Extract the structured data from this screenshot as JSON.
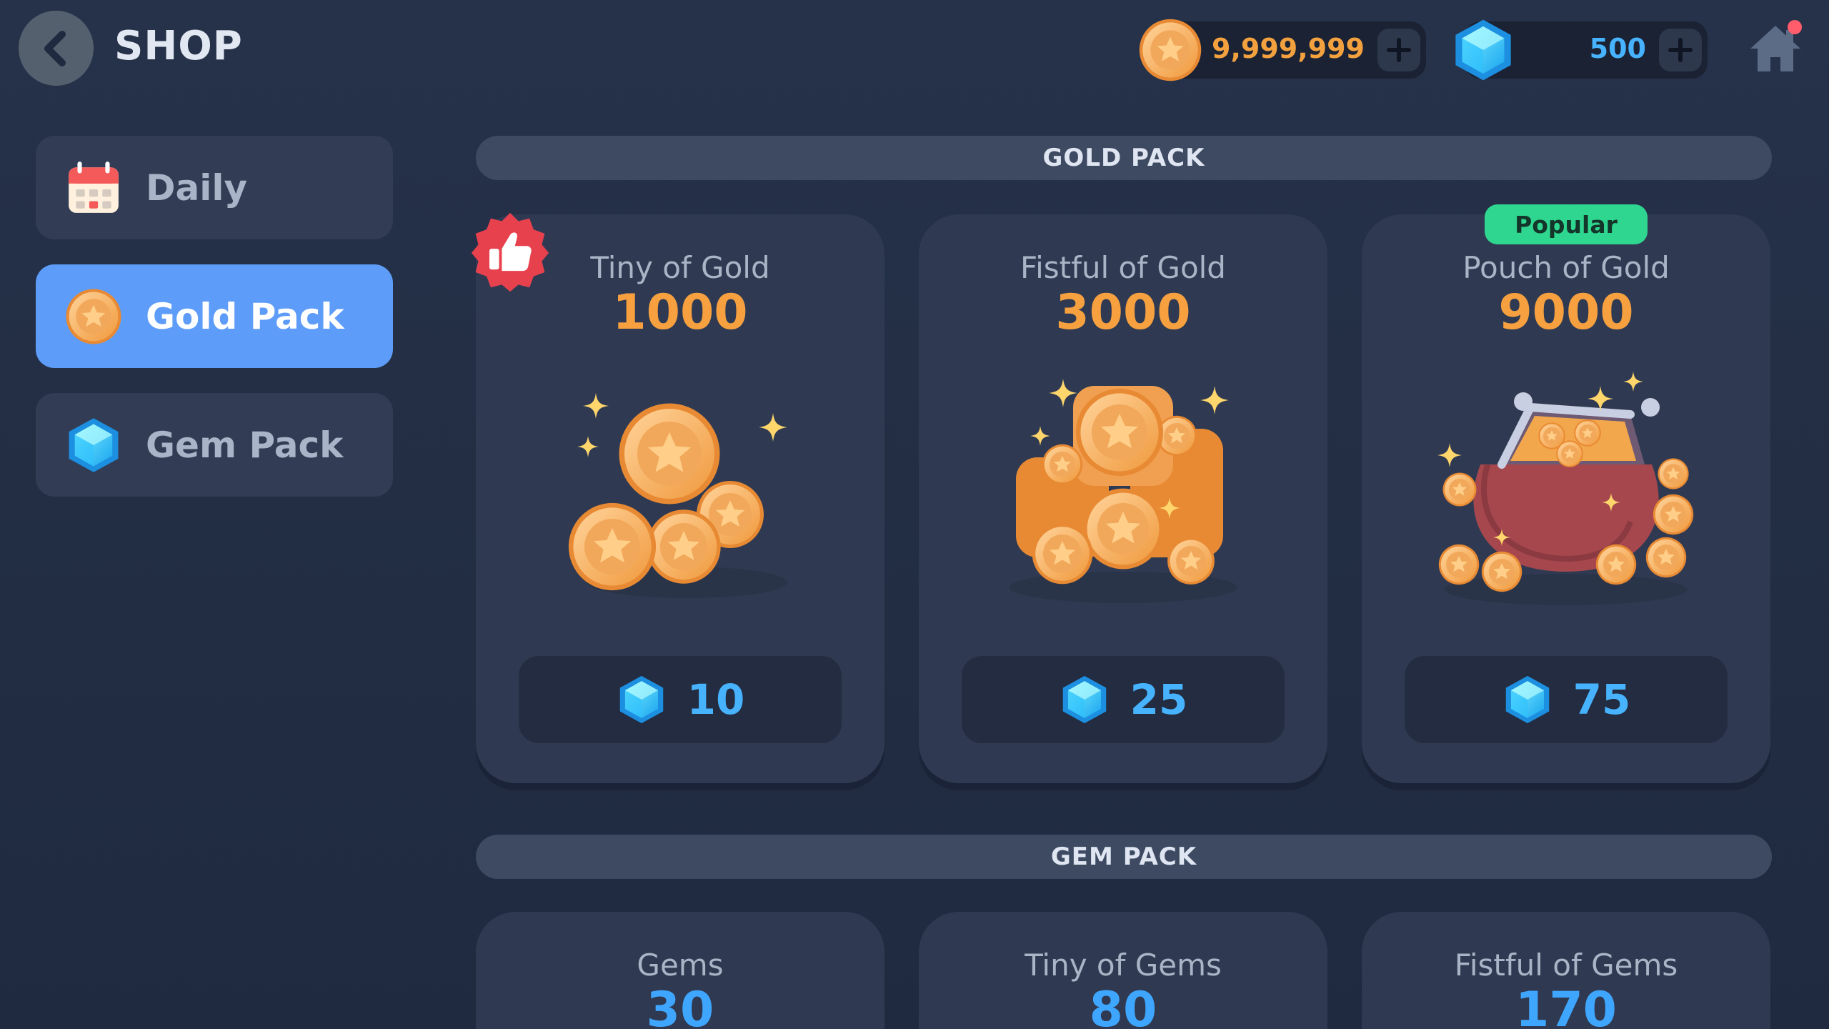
{
  "header": {
    "title": "SHOP",
    "gold_balance": "9,999,999",
    "gem_balance": "500"
  },
  "sidebar": {
    "items": [
      {
        "label": "Daily",
        "icon": "calendar-icon",
        "active": false
      },
      {
        "label": "Gold Pack",
        "icon": "gold-coin-icon",
        "active": true
      },
      {
        "label": "Gem Pack",
        "icon": "gem-icon",
        "active": false
      }
    ]
  },
  "sections": {
    "gold_pack": {
      "title": "GOLD PACK",
      "cards": [
        {
          "name": "Tiny of Gold",
          "amount": "1000",
          "price": "10",
          "badge": "thumbs-up-icon"
        },
        {
          "name": "Fistful of Gold",
          "amount": "3000",
          "price": "25"
        },
        {
          "name": "Pouch of Gold",
          "amount": "9000",
          "price": "75",
          "tag": "Popular"
        }
      ]
    },
    "gem_pack": {
      "title": "GEM PACK",
      "cards": [
        {
          "name": "Gems",
          "amount": "30"
        },
        {
          "name": "Tiny of Gems",
          "amount": "80"
        },
        {
          "name": "Fistful of Gems",
          "amount": "170"
        }
      ]
    }
  },
  "colors": {
    "background": "#26324a",
    "card": "#2f3a52",
    "active_tab": "#5d9cf8",
    "gold_text": "#f6a03f",
    "gem_text": "#47b3ff",
    "popular_tag": "#2fd68f",
    "like_badge": "#e8414e"
  }
}
